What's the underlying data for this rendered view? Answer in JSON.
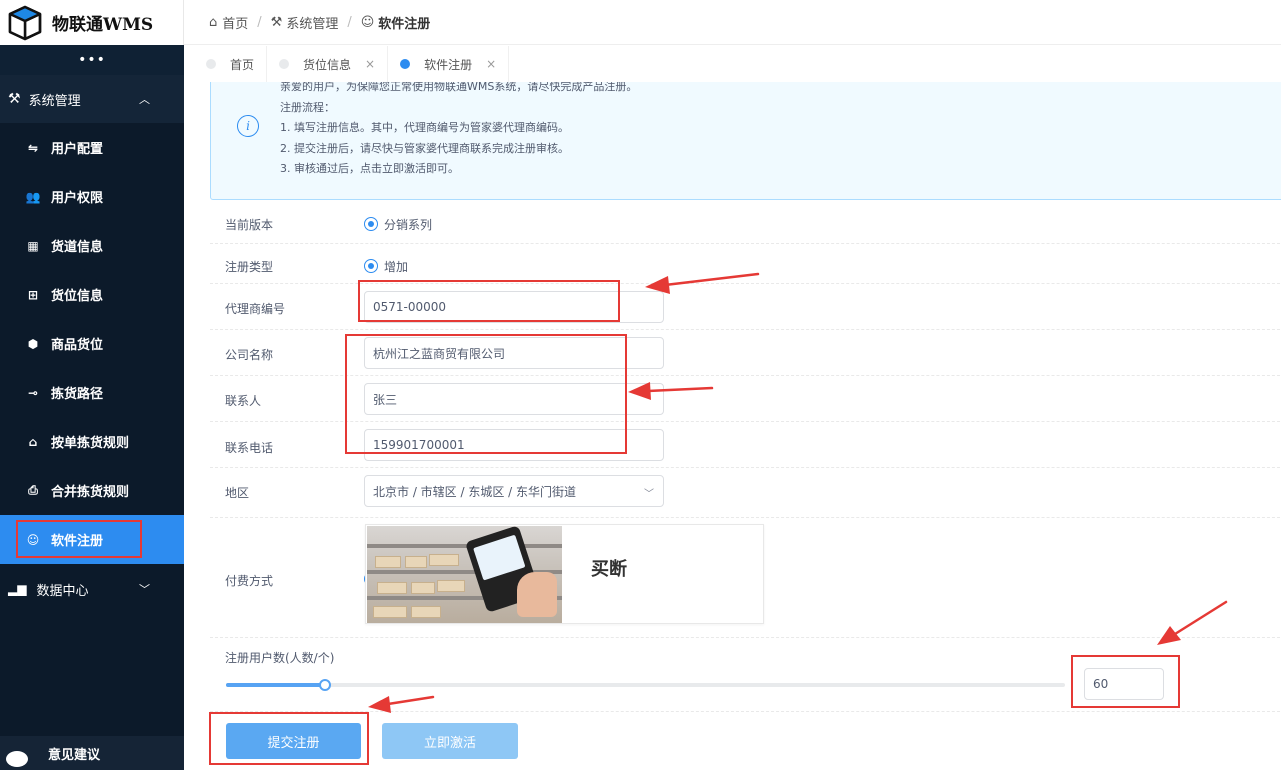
{
  "app": {
    "title": "物联通WMS"
  },
  "sidebar": {
    "collapse_glyph": "•••",
    "group_system": {
      "label": "系统管理",
      "icon": "tools-icon"
    },
    "items": [
      {
        "label": "用户配置",
        "icon": "sliders-icon"
      },
      {
        "label": "用户权限",
        "icon": "users-icon"
      },
      {
        "label": "货道信息",
        "icon": "grid-icon"
      },
      {
        "label": "货位信息",
        "icon": "plus-square-icon"
      },
      {
        "label": "商品货位",
        "icon": "cube-icon"
      },
      {
        "label": "拣货路径",
        "icon": "route-icon"
      },
      {
        "label": "按单拣货规则",
        "icon": "inbox-icon"
      },
      {
        "label": "合并拣货规则",
        "icon": "printer-icon"
      },
      {
        "label": "软件注册",
        "icon": "smile-icon",
        "active": true
      }
    ],
    "group_data": {
      "label": "数据中心",
      "icon": "bar-chart-icon"
    },
    "feedback_label": "意见建议"
  },
  "breadcrumb": {
    "home": "首页",
    "section": "系统管理",
    "current": "软件注册"
  },
  "tabs": [
    {
      "label": "首页",
      "closable": false,
      "active": false
    },
    {
      "label": "货位信息",
      "closable": true,
      "active": false
    },
    {
      "label": "软件注册",
      "closable": true,
      "active": true
    }
  ],
  "tab_close_glyph": "×",
  "notice": {
    "lines": [
      "亲爱的用户，为保障您正常使用物联通WMS系统，请尽快完成产品注册。",
      "注册流程：",
      "1. 填写注册信息。其中，代理商编号为管家婆代理商编码。",
      "2. 提交注册后，请尽快与管家婆代理商联系完成注册审核。",
      "3. 审核通过后，点击立即激活即可。"
    ]
  },
  "form": {
    "version_label": "当前版本",
    "version_value": "分销系列",
    "regtype_label": "注册类型",
    "regtype_value": "增加",
    "agent_label": "代理商编号",
    "agent_value": "0571-00000",
    "company_label": "公司名称",
    "company_value": "杭州江之蓝商贸有限公司",
    "contact_label": "联系人",
    "contact_value": "张三",
    "phone_label": "联系电话",
    "phone_value": "159901700001",
    "region_label": "地区",
    "region_value": "北京市 / 市辖区 / 东城区 / 东华门街道",
    "payment_label": "付费方式",
    "payment_option": "买断",
    "users_label": "注册用户数(人数/个)",
    "users_value": "60",
    "slider_fraction": 0.118
  },
  "buttons": {
    "submit": "提交注册",
    "activate": "立即激活"
  },
  "colors": {
    "accent": "#2d8cf0",
    "sidebar_bg": "#0c1a2a",
    "annotation": "#e53935"
  }
}
